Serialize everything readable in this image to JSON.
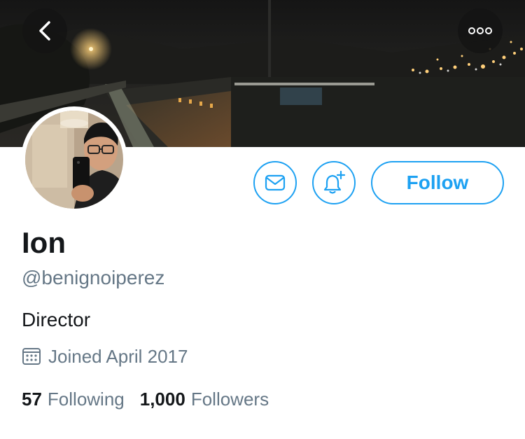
{
  "header": {
    "back_icon": "chevron-left-icon",
    "more_icon": "more-horizontal-icon"
  },
  "profile": {
    "display_name": "Ion",
    "handle": "@benignoiperez",
    "bio": "Director",
    "joined": "Joined April 2017",
    "joined_icon": "calendar-icon"
  },
  "actions": {
    "message_icon": "envelope-icon",
    "notify_icon": "bell-plus-icon",
    "follow_label": "Follow"
  },
  "stats": {
    "following_count": "57",
    "following_label": "Following",
    "followers_count": "1,000",
    "followers_label": "Followers"
  },
  "colors": {
    "accent": "#1da1f2",
    "secondary_text": "#657786",
    "primary_text": "#14171a"
  }
}
